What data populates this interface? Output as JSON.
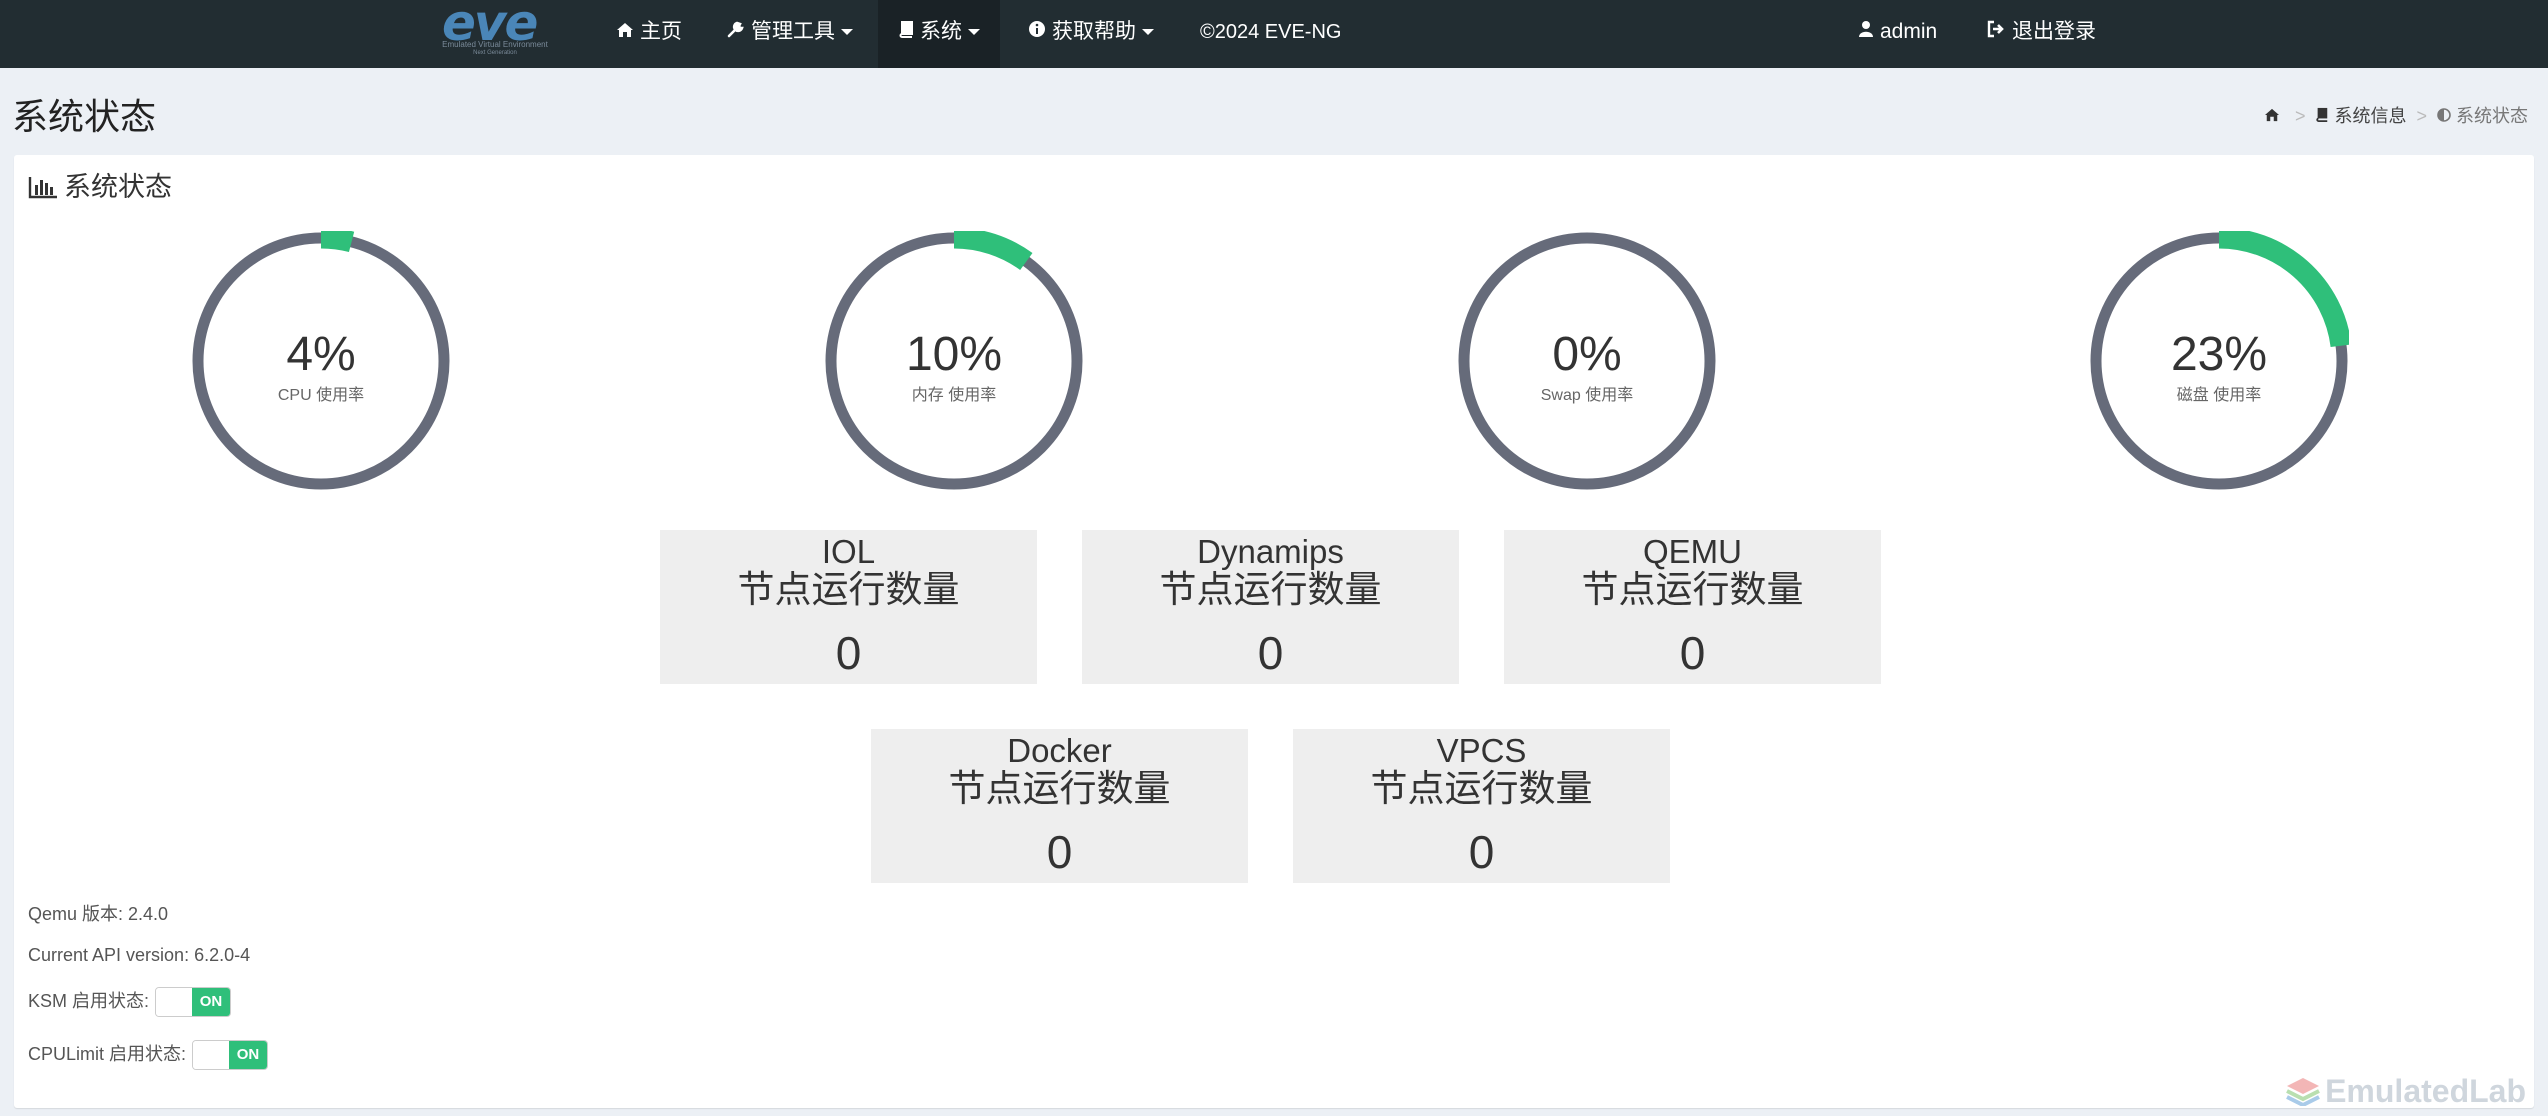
{
  "logo": {
    "word": "eve",
    "subtitle": "Emulated Virtual Environment",
    "edition": "Next Generation"
  },
  "nav": {
    "home": "主页",
    "tools": "管理工具",
    "system": "系统",
    "help": "获取帮助",
    "copyright": "©2024 EVE-NG",
    "user": "admin",
    "logout": "退出登录"
  },
  "page": {
    "title": "系统状态"
  },
  "breadcrumb": {
    "sysinfo": "系统信息",
    "current": "系统状态"
  },
  "box": {
    "title": "系统状态"
  },
  "gauges": [
    {
      "value": "4%",
      "label": "CPU 使用率",
      "fraction": 0.04
    },
    {
      "value": "10%",
      "label": "内存 使用率",
      "fraction": 0.1
    },
    {
      "value": "0%",
      "label": "Swap 使用率",
      "fraction": 0.0
    },
    {
      "value": "23%",
      "label": "磁盘 使用率",
      "fraction": 0.23
    }
  ],
  "tiles": [
    {
      "name": "IOL",
      "sub": "节点运行数量",
      "count": "0"
    },
    {
      "name": "Dynamips",
      "sub": "节点运行数量",
      "count": "0"
    },
    {
      "name": "QEMU",
      "sub": "节点运行数量",
      "count": "0"
    },
    {
      "name": "Docker",
      "sub": "节点运行数量",
      "count": "0"
    },
    {
      "name": "VPCS",
      "sub": "节点运行数量",
      "count": "0"
    }
  ],
  "info": {
    "qemu": "Qemu 版本: 2.4.0",
    "api": "Current API version: 6.2.0-4",
    "ksm_label": "KSM 启用状态:",
    "ksm_state": "ON",
    "cpulimit_label": "CPULimit 启用状态:",
    "cpulimit_state": "ON"
  },
  "watermark": "EmulatedLab",
  "colors": {
    "navbar": "#222d32",
    "gauge_track": "#666b7a",
    "gauge_fill": "#2fbf7a",
    "switch_on": "#2fbf7a"
  },
  "icons": {
    "home": "home-icon",
    "tools": "wrench-icon",
    "system": "book-icon",
    "help": "info-circle-icon",
    "user": "user-icon",
    "logout": "sign-out-icon",
    "box": "bar-chart-icon",
    "current": "adjust-icon"
  }
}
